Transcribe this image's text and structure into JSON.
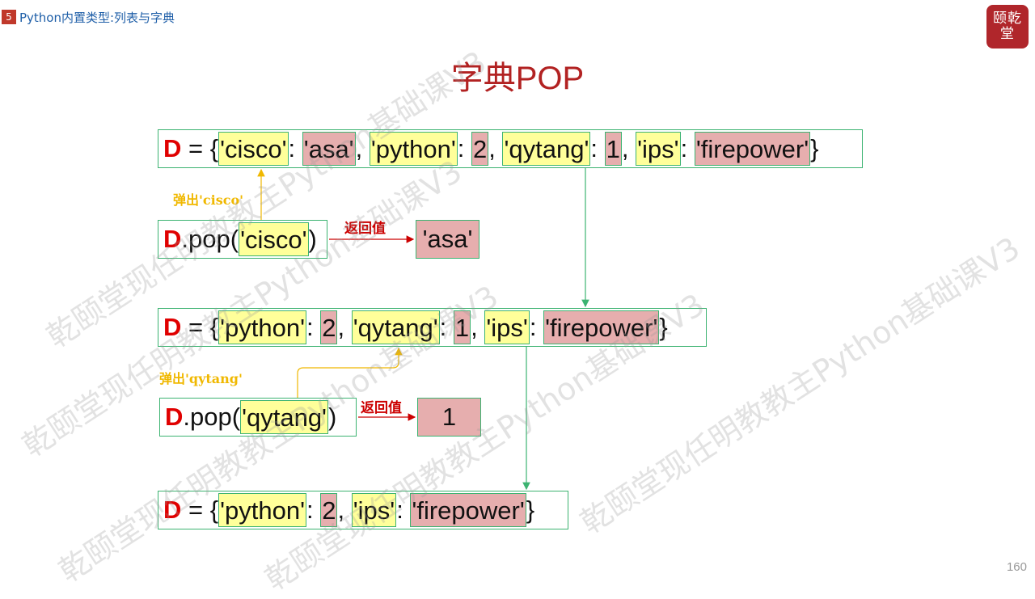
{
  "header": {
    "chapter_number": "5",
    "title": "Python内置类型:列表与字典"
  },
  "logo": {
    "text": "颐乾堂"
  },
  "page_title": "字典POP",
  "page_number": "160",
  "rows": {
    "row1": {
      "var": "D",
      "eq": " = {",
      "k1": "'cisco'",
      "v1": "'asa'",
      "k2": "'python'",
      "v2": "2",
      "k3": "'qytang'",
      "v3": "1",
      "k4": "'ips'",
      "v4": "'firepower'",
      "colon": ": ",
      "sep": ", ",
      "close": "}"
    },
    "pop1": {
      "var": "D",
      "call": ".pop(",
      "arg": "'cisco'",
      "close": ")"
    },
    "row2": {
      "var": "D",
      "eq": " = {",
      "k1": "'python'",
      "v1": "2",
      "k2": "'qytang'",
      "v2": "1",
      "k3": "'ips'",
      "v3": "'firepower'",
      "colon": ": ",
      "sep": ", ",
      "close": "}"
    },
    "pop2": {
      "var": "D",
      "call": ".pop(",
      "arg": "'qytang'",
      "close": ")"
    },
    "row3": {
      "var": "D",
      "eq": " = {",
      "k1": "'python'",
      "v1": "2",
      "k2": "'ips'",
      "v2": "'firepower'",
      "colon": ": ",
      "sep": ", ",
      "close": "}"
    }
  },
  "returns": {
    "ret1": "'asa'",
    "ret2": "1",
    "label": "返回值"
  },
  "pop_labels": {
    "pop1": "弹出'cisco'",
    "pop2": "弹出'qytang'"
  },
  "watermark": {
    "line_a": "乾颐堂现任明教教主",
    "line_b": "Python基础课V3"
  },
  "colors": {
    "accent_red": "#b22222",
    "key_fill": "#ffff9a",
    "value_fill": "#e6aeae",
    "box_border": "#3cb371",
    "pop_arrow": "#f0b800",
    "return_arrow": "#cc0000"
  }
}
